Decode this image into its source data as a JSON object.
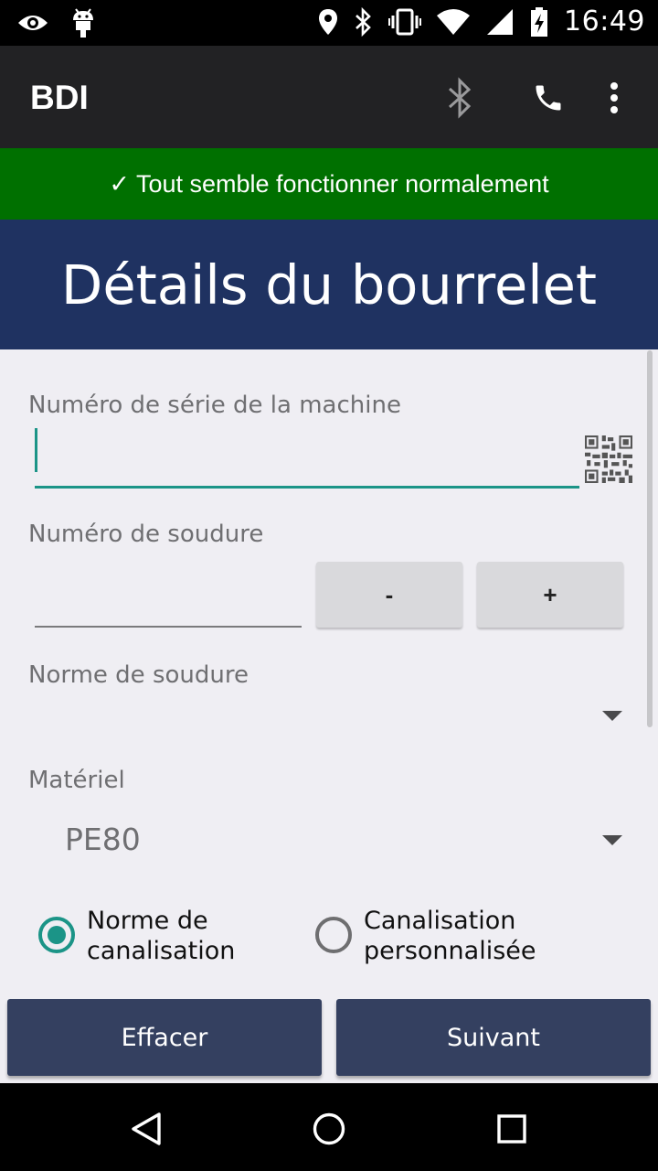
{
  "status_bar": {
    "time": "16:49",
    "icons": [
      "eye-icon",
      "android-icon",
      "location-icon",
      "bluetooth-icon",
      "vibrate-icon",
      "wifi-icon",
      "signal-icon",
      "battery-icon"
    ]
  },
  "app_bar": {
    "title": "BDI",
    "actions": [
      "bluetooth-icon",
      "phone-icon",
      "more-vert-icon"
    ]
  },
  "banner": {
    "text": "✓ Tout semble fonctionner normalement",
    "color": "#007000"
  },
  "header": {
    "title": "Détails du bourrelet",
    "color": "#1f3261"
  },
  "form": {
    "serial_label": "Numéro de série de la machine",
    "serial_value": "",
    "weld_label": "Numéro de soudure",
    "weld_value": "",
    "minus_label": "-",
    "plus_label": "+",
    "standard_label": "Norme de soudure",
    "standard_value": "",
    "material_label": "Matériel",
    "material_value": "PE80",
    "radio_options": [
      {
        "label": "Norme de canalisation",
        "selected": true
      },
      {
        "label": "Canalisation personnalisée",
        "selected": false
      }
    ]
  },
  "buttons": {
    "clear": "Effacer",
    "next": "Suivant"
  },
  "colors": {
    "accent": "#1b9487",
    "button": "#344060"
  },
  "nav_bar": [
    "back-icon",
    "home-icon",
    "recents-icon"
  ]
}
